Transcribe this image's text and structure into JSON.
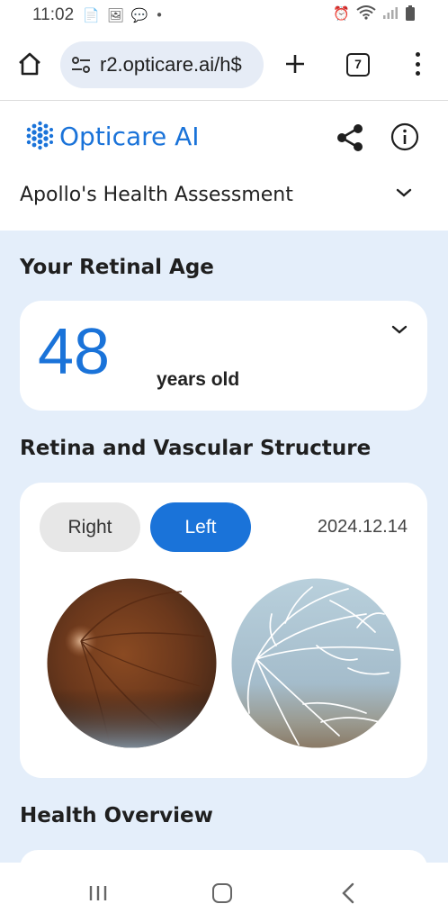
{
  "status_bar": {
    "time": "11:02"
  },
  "browser": {
    "url": "r2.opticare.ai/h$",
    "tab_count": "7"
  },
  "header": {
    "brand": "Opticare AI",
    "page_title": "Apollo's Health Assessment"
  },
  "retinal_age": {
    "section_title": "Your Retinal Age",
    "value": "48",
    "unit": "years old"
  },
  "retina": {
    "section_title": "Retina and Vascular Structure",
    "tabs": [
      "Right",
      "Left"
    ],
    "selected_tab": "Left",
    "date": "2024.12.14"
  },
  "health_overview": {
    "section_title": "Health Overview"
  },
  "colors": {
    "brand_blue": "#1a73d9",
    "content_bg": "#e4eefa"
  }
}
